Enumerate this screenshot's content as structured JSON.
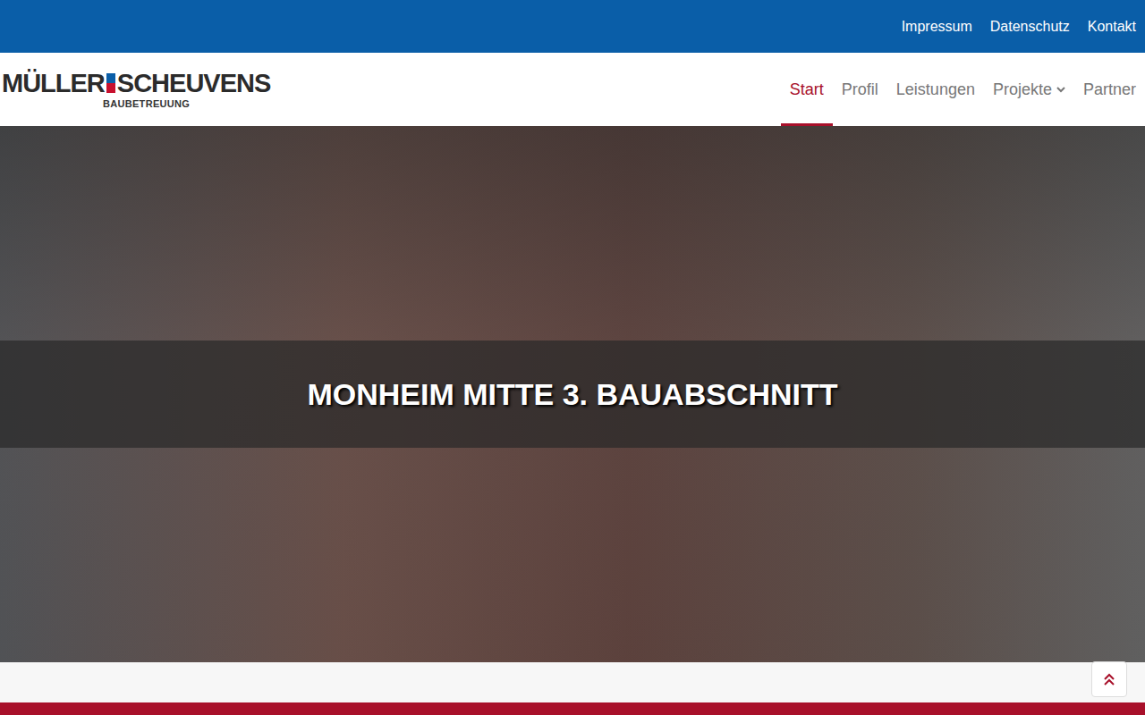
{
  "topbar": {
    "links": [
      "Impressum",
      "Datenschutz",
      "Kontakt"
    ]
  },
  "logo": {
    "left": "MÜLLER",
    "right": "SCHEUVENS",
    "sub": "BAUBETREUUNG"
  },
  "nav": [
    {
      "label": "Start",
      "selected": true,
      "dropdown": false
    },
    {
      "label": "Profil",
      "selected": false,
      "dropdown": false
    },
    {
      "label": "Leistungen",
      "selected": false,
      "dropdown": false
    },
    {
      "label": "Projekte",
      "selected": false,
      "dropdown": true
    },
    {
      "label": "Partner",
      "selected": false,
      "dropdown": false
    }
  ],
  "hero": {
    "title": "MONHEIM MITTE 3. BAUABSCHNITT"
  }
}
